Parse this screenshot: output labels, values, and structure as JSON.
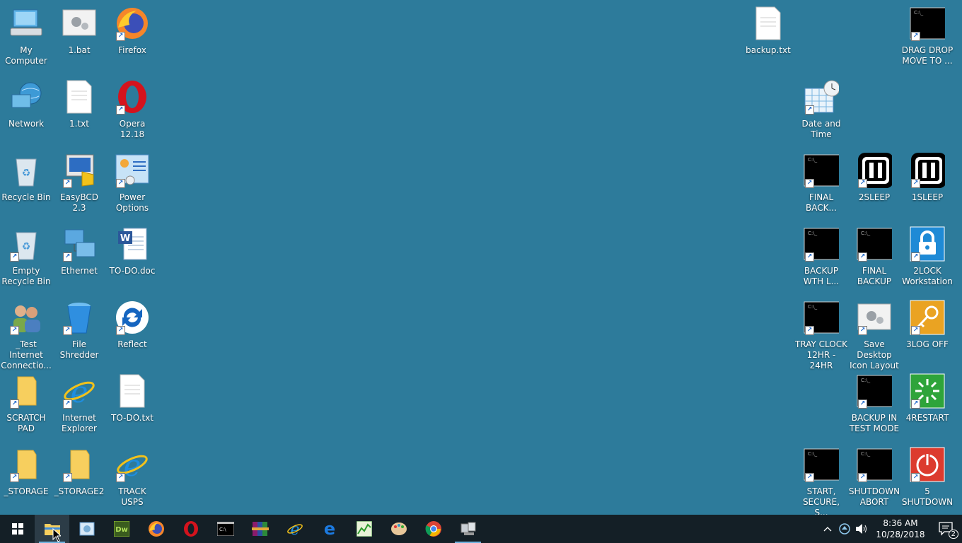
{
  "desktop_icons": {
    "my_computer": "My\nComputer",
    "bat1": "1.bat",
    "firefox": "Firefox",
    "network": "Network",
    "txt1": "1.txt",
    "opera": "Opera 12.18",
    "recycle_bin": "Recycle Bin",
    "easybcd": "EasyBCD 2.3",
    "power_options": "Power\nOptions",
    "empty_recycle_bin": "Empty\nRecycle Bin",
    "ethernet": "Ethernet",
    "todo_doc": "TO-DO.doc",
    "test_internet": "_Test Internet\nConnectio...",
    "file_shredder": "File Shredder",
    "reflect": "Reflect",
    "scratch_pad": "SCRATCH\nPAD",
    "internet_explorer": "Internet\nExplorer",
    "todo_txt": "TO-DO.txt",
    "storage": "_STORAGE",
    "storage2": "_STORAGE2",
    "track_usps": "TRACK USPS",
    "backup_txt": "backup.txt",
    "drag_drop": "DRAG DROP\nMOVE TO ...",
    "date_time": "Date and\nTime",
    "final_back": "FINAL\nBACK...",
    "sleep2": "2SLEEP",
    "sleep1": "1SLEEP",
    "backup_wth": "BACKUP\nWTH L...",
    "final_backup": "FINAL\nBACKUP",
    "lock2": "2LOCK\nWorkstation",
    "tray_clock": "TRAY CLOCK\n12HR - 24HR",
    "save_layout": "Save Desktop\nIcon Layout",
    "log_off": "3LOG OFF",
    "backup_test": "BACKUP IN\nTEST MODE",
    "restart": "4RESTART",
    "start_secure": "START,\nSECURE, S...",
    "shutdown_abort": "SHUTDOWN\nABORT",
    "shutdown5": "5\nSHUTDOWN"
  },
  "taskbar": {
    "pinned": [
      "start",
      "file-explorer",
      "control-panel",
      "dreamweaver",
      "firefox",
      "opera",
      "command-prompt",
      "winrar",
      "internet-explorer",
      "edge",
      "task-manager",
      "paint",
      "chrome",
      "network-tool"
    ],
    "clock_time": "8:36 AM",
    "clock_date": "10/28/2018",
    "notification_count": "2"
  },
  "colors": {
    "desktop": "#2d7b9b",
    "taskbar": "#141f26"
  }
}
